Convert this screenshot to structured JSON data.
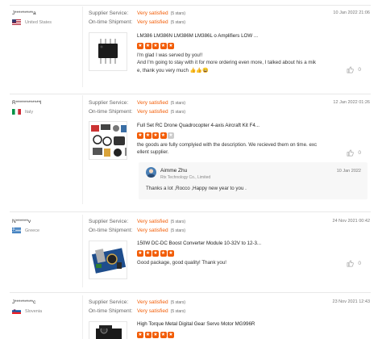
{
  "labels": {
    "seller_service": "Supplier Service:",
    "shipment": "On-time Shipment:"
  },
  "reviews": [
    {
      "buyer": "J*********a",
      "country": "United States",
      "seller_value": "Very satisfied",
      "seller_stars": "(5 stars)",
      "shipment_value": "Very satisfied",
      "shipment_stars": "(5 stars)",
      "date": "10 Jan 2022 21:06",
      "product_title": "LM386 LM386N LM386M LM386L o Amplifiers LOW ...",
      "rating": 5,
      "text_lines": [
        "I'm glad I was served by you!!",
        "And I'm going to stay with it for more ordering even more, I talked about his a mik",
        "e, thank you very much 👍👍😀"
      ],
      "likes": "0",
      "flag": "us-flag"
    },
    {
      "buyer": "R************l",
      "country": "Italy",
      "seller_value": "Very satisfied",
      "seller_stars": "(5 stars)",
      "shipment_value": "Very satisfied",
      "shipment_stars": "(5 stars)",
      "date": "12 Jan 2022 01:26",
      "product_title": "Full Set RC Drone Quadrocopter 4-axis Aircraft Kit F4...",
      "rating": 4,
      "text_lines": [
        "the goods are fully complyied with the description. We recieved them on time. exc",
        "ellent supplier."
      ],
      "likes": "0",
      "flag": "it-flag",
      "reply": {
        "name": "Aimme Zhu",
        "org": "Rtx Technology Co., Limited",
        "date": "10 Jan 2022",
        "text": "Thanks a lot ,Rocco ,Happy new year to you ."
      }
    },
    {
      "buyer": "N******v",
      "country": "Greece",
      "seller_value": "Very satisfied",
      "seller_stars": "(5 stars)",
      "shipment_value": "Very satisfied",
      "shipment_stars": "(5 stars)",
      "date": "24 Nov 2021 00:42",
      "product_title": "150W DC-DC Boost Converter Module 10-32V to 12-3...",
      "rating": 5,
      "text_lines": [
        "Good package, good quality! Thank you!"
      ],
      "likes": "0",
      "flag": "gr-flag"
    },
    {
      "buyer": "J*********c",
      "country": "Slovenia",
      "seller_value": "Very satisfied",
      "seller_stars": "(5 stars)",
      "shipment_value": "Very satisfied",
      "shipment_stars": "(5 stars)",
      "date": "23 Nov 2021 12:43",
      "product_title": "High Torque Metal Digital Gear Servo Motor MG996R",
      "rating": 5,
      "text_lines": [],
      "likes": "",
      "flag": "si-flag"
    }
  ],
  "colors": {
    "accent": "#f25c05",
    "star_off": "#cccccc"
  }
}
